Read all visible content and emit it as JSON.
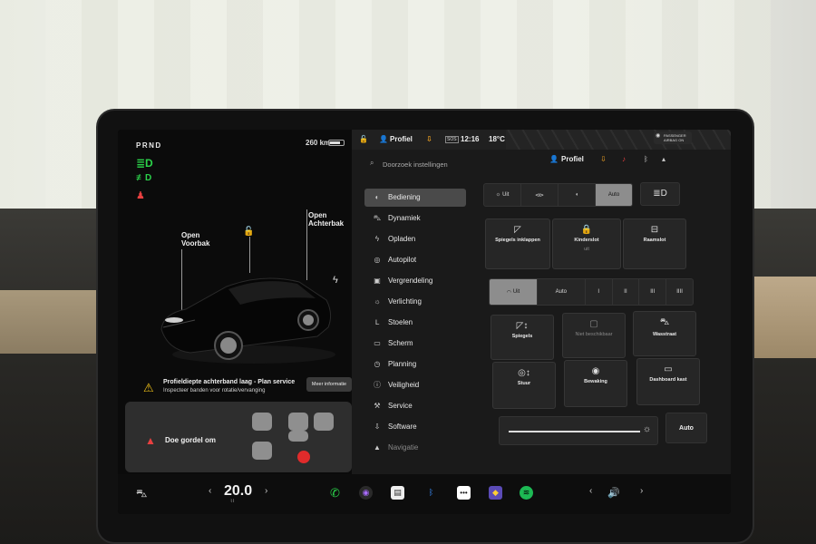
{
  "vehicle": {
    "gear": "PRND",
    "range": "260 km",
    "labels": {
      "frunk_open": "Open",
      "frunk_name": "Voorbak",
      "trunk_open": "Open",
      "trunk_name": "Achterbak"
    }
  },
  "alert": {
    "title": "Profieldiepte achterband laag - Plan service",
    "subtitle": "Inspecteer banden voor rotatie/vervanging",
    "button": "Meer informatie"
  },
  "seatbelt": {
    "text": "Doe gordel om"
  },
  "topbar": {
    "profile": "Profiel",
    "time": "12:16",
    "temp": "18°C",
    "sos": "SOS",
    "passenger_airbag": "PASSENGER AIRBAG ON"
  },
  "settings": {
    "search_placeholder": "Doorzoek instellingen",
    "profile": "Profiel",
    "nav": [
      {
        "label": "Bediening",
        "icon": "toggle-icon"
      },
      {
        "label": "Dynamiek",
        "icon": "car-icon"
      },
      {
        "label": "Opladen",
        "icon": "bolt-icon"
      },
      {
        "label": "Autopilot",
        "icon": "steering-icon"
      },
      {
        "label": "Vergrendeling",
        "icon": "lock-icon"
      },
      {
        "label": "Verlichting",
        "icon": "sun-icon"
      },
      {
        "label": "Stoelen",
        "icon": "seat-icon"
      },
      {
        "label": "Scherm",
        "icon": "display-icon"
      },
      {
        "label": "Planning",
        "icon": "clock-icon"
      },
      {
        "label": "Veiligheid",
        "icon": "shield-icon"
      },
      {
        "label": "Service",
        "icon": "wrench-icon"
      },
      {
        "label": "Software",
        "icon": "download-icon"
      },
      {
        "label": "Navigatie",
        "icon": "navigation-icon"
      }
    ],
    "lights_segment": [
      "Uit",
      "",
      "",
      "Auto"
    ],
    "row2": [
      {
        "label": "Spiegels inklappen"
      },
      {
        "label": "Kinderslot",
        "sub": "uit"
      },
      {
        "label": "Raamslot"
      }
    ],
    "wiper_segment": [
      "Uit",
      "Auto",
      "I",
      "II",
      "III",
      "IIII"
    ],
    "row4": [
      {
        "label": "Spiegels"
      },
      {
        "label": "Niet beschikbaar"
      },
      {
        "label": "Wasstraat"
      }
    ],
    "row5": [
      {
        "label": "Stuur"
      },
      {
        "label": "Bewaking"
      },
      {
        "label": "Dashboard kast"
      }
    ],
    "brightness_auto": "Auto"
  },
  "taskbar": {
    "temperature": "20.0"
  }
}
